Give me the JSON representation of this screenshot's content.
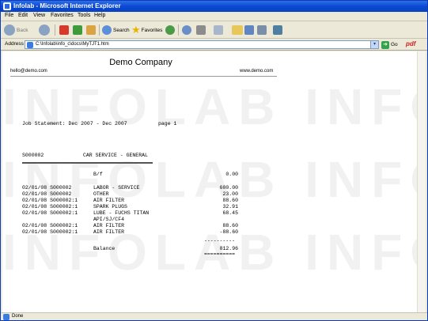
{
  "window": {
    "title": "Infolab - Microsoft Internet Explorer"
  },
  "menu": [
    "File",
    "Edit",
    "View",
    "Favorites",
    "Tools",
    "Help"
  ],
  "toolbar": {
    "back_label": "Back",
    "search_label": "Search",
    "favorites_label": "Favorites"
  },
  "address": {
    "label": "Address",
    "url": "C:\\Infolab\\info_c\\docs\\MyTJT1.htm",
    "go_label": "Go",
    "pdf_label": "pdf"
  },
  "document": {
    "company": "Demo Company",
    "email": "hello@demo.com",
    "website": "www.demo.com",
    "statement_title": "Job Statement: Dec 2007 - Dec 2007",
    "page_label": "page 1",
    "account_code": "S000002",
    "account_desc": "CAR SERVICE - GENERAL",
    "rows": [
      {
        "date": "",
        "desc": "B/f",
        "amount": "0.00"
      },
      {
        "date": "02/01/08 S000002",
        "desc": "LABOR - SERVICE",
        "amount": "600.00"
      },
      {
        "date": "02/01/08 S000002",
        "desc": "OTHER",
        "amount": "23.00"
      },
      {
        "date": "02/01/08 S000002:1",
        "desc": "AIR FILTER",
        "amount": "88.60"
      },
      {
        "date": "02/01/08 S000002:1",
        "desc": "SPARK PLUGS",
        "amount": "32.91"
      },
      {
        "date": "02/01/08 S000002:1",
        "desc": "LUBE - FUCHS TITAN",
        "amount": "68.45"
      },
      {
        "date": "",
        "desc": "API/SJ/CF4",
        "amount": ""
      },
      {
        "date": "02/01/08 S000002:1",
        "desc": "AIR FILTER",
        "amount": "88.60"
      },
      {
        "date": "02/01/08 S000002:1",
        "desc": "AIR FILTER",
        "amount": "-88.60"
      }
    ],
    "dash_line": "----------",
    "balance_label": "Balance",
    "balance_amount": "812.96",
    "double_line": "=========="
  },
  "watermark": "INFOLAB INFOLAB",
  "status": {
    "text": "Done"
  }
}
